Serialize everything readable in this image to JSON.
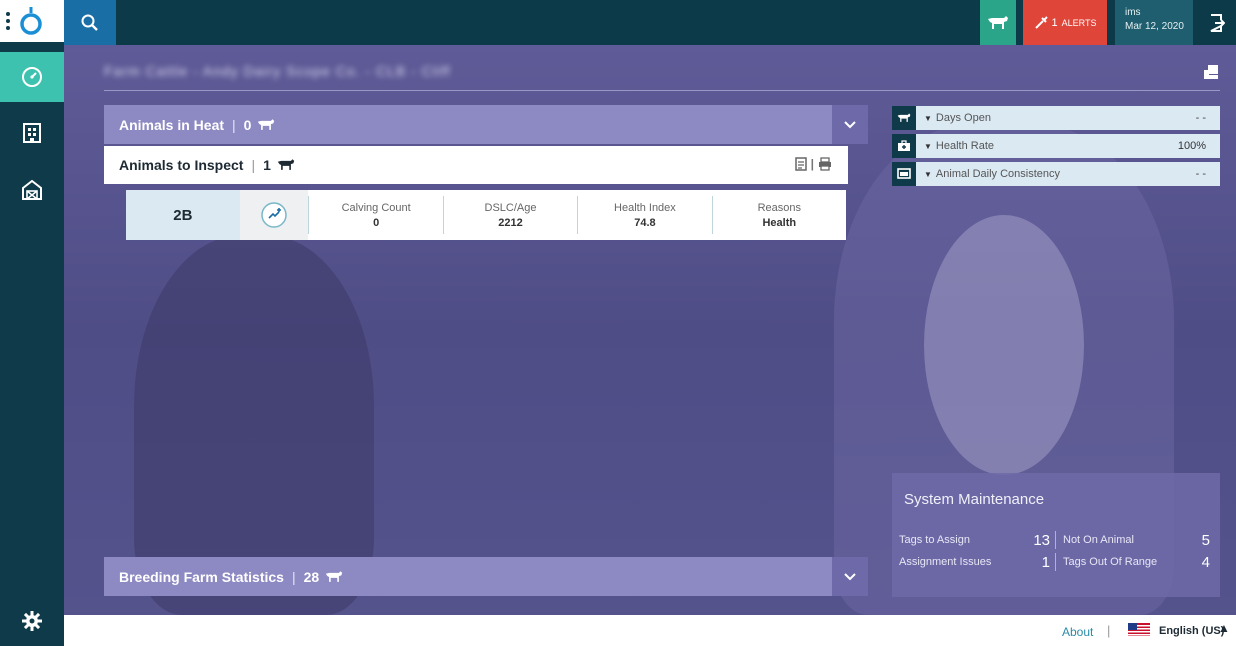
{
  "topbar": {
    "alerts_count": "1",
    "alerts_label": "ALERTS",
    "user_name": "ims",
    "date": "Mar 12, 2020"
  },
  "main": {
    "farm_title": "Farm Cattle - Andy Dairy Scope Co. - CLB - Cliff"
  },
  "panels": {
    "heat": {
      "title": "Animals in Heat",
      "count": "0"
    },
    "inspect": {
      "title": "Animals to Inspect",
      "count": "1"
    },
    "breeding": {
      "title": "Breeding Farm Statistics",
      "count": "28"
    }
  },
  "animal_row": {
    "id": "2B",
    "stats": [
      {
        "label": "Calving Count",
        "value": "0"
      },
      {
        "label": "DSLC/Age",
        "value": "2212"
      },
      {
        "label": "Health Index",
        "value": "74.8"
      },
      {
        "label": "Reasons",
        "value": "Health"
      }
    ]
  },
  "widgets": [
    {
      "label": "Days Open",
      "value": "- -",
      "icon": "cow-icon"
    },
    {
      "label": "Health Rate",
      "value": "100%",
      "icon": "first-aid-icon"
    },
    {
      "label": "Animal Daily Consistency",
      "value": "- -",
      "icon": "monitor-icon"
    }
  ],
  "maintenance": {
    "title": "System Maintenance",
    "rows": [
      {
        "label1": "Tags to Assign",
        "value1": "13",
        "label2": "Not On Animal",
        "value2": "5"
      },
      {
        "label1": "Assignment Issues",
        "value1": "1",
        "label2": "Tags Out Of Range",
        "value2": "4"
      }
    ]
  },
  "footer": {
    "about": "About",
    "separator": "|",
    "language": "English (US)"
  },
  "colors": {
    "rail": "#0f3a49",
    "accent": "#3ec2b0",
    "alert": "#e0453a",
    "panel": "#8d89c2"
  }
}
